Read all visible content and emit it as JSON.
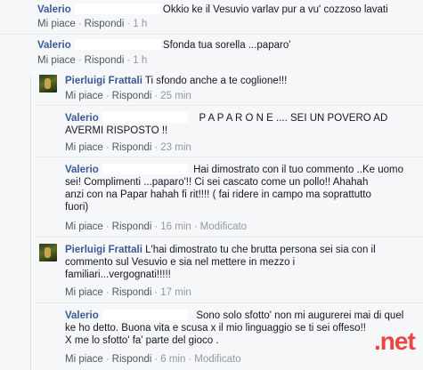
{
  "comments": [
    {
      "author": "Valerio",
      "text": "Okkio ke il Vesuvio varlav pur a vu' cozzoso lavati",
      "like": "Mi piace",
      "reply": "Rispondi",
      "time": "1 h"
    },
    {
      "author": "Valerio",
      "text": "Sfonda tua sorella ...paparo'",
      "like": "Mi piace",
      "reply": "Rispondi",
      "time": "1 h"
    }
  ],
  "replies": [
    {
      "author": "Pierluigi Frattali",
      "text": "Ti sfondo anche a te coglione!!!",
      "like": "Mi piace",
      "reply": "Rispondi",
      "time": "25 min"
    },
    {
      "author": "Valerio",
      "text_line1": "P A P A R O N E .... SEI UN POVERO AD",
      "text_line2": "AVERMI RISPOSTO !!",
      "like": "Mi piace",
      "reply": "Rispondi",
      "time": "23 min"
    },
    {
      "author": "Valerio",
      "text_line1": "Hai dimostrato con il tuo commento ..Ke uomo",
      "text_line2": "sei! Complimenti ...paparo'!! Ci sei cascato come un pollo!! Ahahah",
      "text_line3": "anzi con na Papar hahah fi rit!!!! ( fai ridere in campo ma soprattutto",
      "text_line4": "fuori)",
      "like": "Mi piace",
      "reply": "Rispondi",
      "time": "16 min",
      "modified": "Modificato"
    },
    {
      "author": "Pierluigi Frattali",
      "text_line1": "L'hai dimostrato tu che brutta persona sei sia con il",
      "text_line2": "commento sul Vesuvio e sia nel mettere in mezzo i",
      "text_line3": "familiari...vergognati!!!!!",
      "like": "Mi piace",
      "reply": "Rispondi",
      "time": "17 min"
    },
    {
      "author": "Valerio",
      "text_line1": "Sono solo sfotto' non mi augurerei mai di quel",
      "text_line2": "ke ho detto. Buona vita e scusa x il mio linguaggio se ti sei offeso!!",
      "text_line3": "X me lo sfotto' fa' parte del gioco .",
      "like": "Mi piace",
      "reply": "Rispondi",
      "time": "6 min",
      "modified": "Modificato"
    }
  ],
  "separator": "·",
  "watermark": ".net",
  "colors": {
    "link": "#3b5998",
    "meta": "#9197a3",
    "watermark": "#e8473c"
  }
}
